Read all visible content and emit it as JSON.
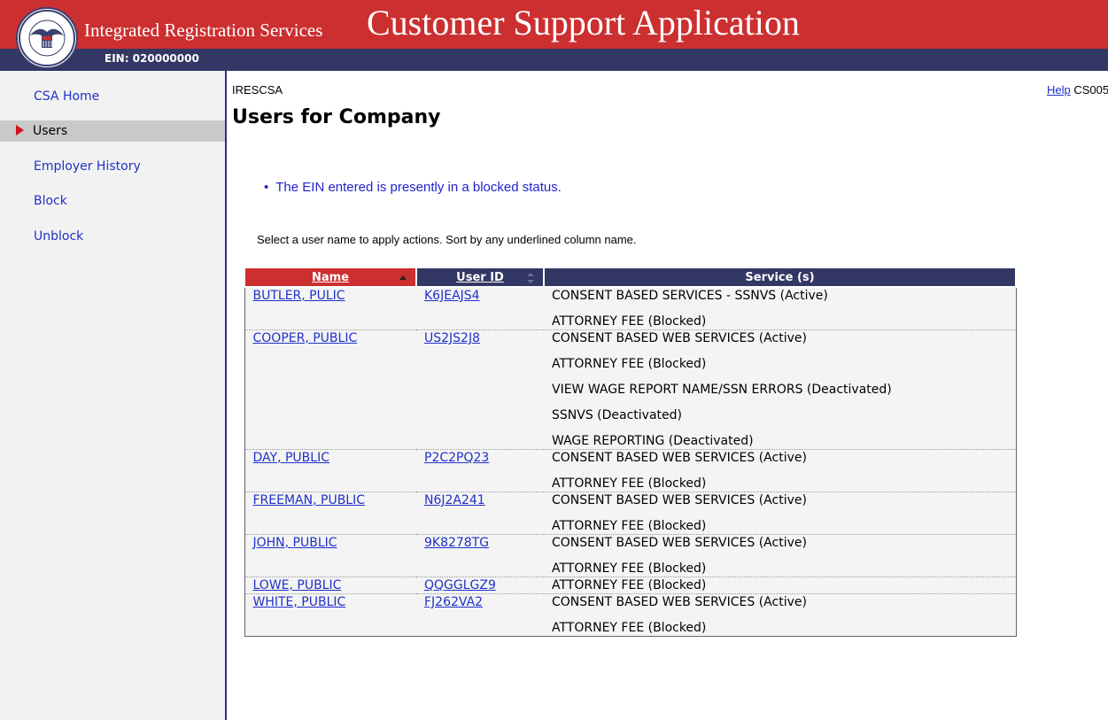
{
  "header": {
    "subtitle": "Integrated Registration Services",
    "title": "Customer Support Application",
    "ein": "EIN: 020000000",
    "logo_text": "SOCIAL SECURITY ADMINISTRATION USA"
  },
  "sidebar": {
    "items": [
      {
        "label": "CSA Home"
      },
      {
        "label": "Users"
      },
      {
        "label": "Employer History"
      },
      {
        "label": "Block"
      },
      {
        "label": "Unblock"
      }
    ]
  },
  "main": {
    "crumb": "IRESCSA",
    "help_link": "Help",
    "screen_code": "CS005",
    "page_title": "Users for Company",
    "message": "The EIN entered is presently in a blocked status.",
    "instructions": "Select a user name to apply actions. Sort by any underlined column name."
  },
  "table": {
    "columns": [
      {
        "label": "Name"
      },
      {
        "label": "User ID"
      },
      {
        "label": "Service (s)"
      }
    ],
    "rows": [
      {
        "name": "BUTLER, PULIC",
        "user_id": "K6JEAJS4",
        "services": [
          "CONSENT BASED SERVICES - SSNVS (Active)",
          "ATTORNEY FEE (Blocked)"
        ]
      },
      {
        "name": "COOPER, PUBLIC",
        "user_id": "US2JS2J8",
        "services": [
          "CONSENT BASED WEB SERVICES (Active)",
          "ATTORNEY FEE (Blocked)",
          "VIEW WAGE REPORT NAME/SSN ERRORS (Deactivated)",
          "SSNVS (Deactivated)",
          "WAGE REPORTING (Deactivated)"
        ]
      },
      {
        "name": "DAY, PUBLIC",
        "user_id": "P2C2PQ23",
        "services": [
          "CONSENT BASED WEB SERVICES (Active)",
          "ATTORNEY FEE (Blocked)"
        ]
      },
      {
        "name": "FREEMAN, PUBLIC",
        "user_id": "N6J2A241",
        "services": [
          "CONSENT BASED WEB SERVICES (Active)",
          "ATTORNEY FEE (Blocked)"
        ]
      },
      {
        "name": "JOHN, PUBLIC",
        "user_id": "9K8278TG",
        "services": [
          "CONSENT BASED WEB SERVICES (Active)",
          "ATTORNEY FEE (Blocked)"
        ]
      },
      {
        "name": "LOWE, PUBLIC",
        "user_id": "QQGGLGZ9",
        "services": [
          "ATTORNEY FEE (Blocked)"
        ]
      },
      {
        "name": "WHITE, PUBLIC",
        "user_id": "FJ262VA2",
        "services": [
          "CONSENT BASED WEB SERVICES (Active)",
          "ATTORNEY FEE (Blocked)"
        ]
      }
    ]
  },
  "colors": {
    "header_red": "#cc2f30",
    "header_navy": "#333764",
    "link_blue": "#1f31c9",
    "message_blue": "#2222cc",
    "active_nav_bg": "#c9c9c9"
  }
}
